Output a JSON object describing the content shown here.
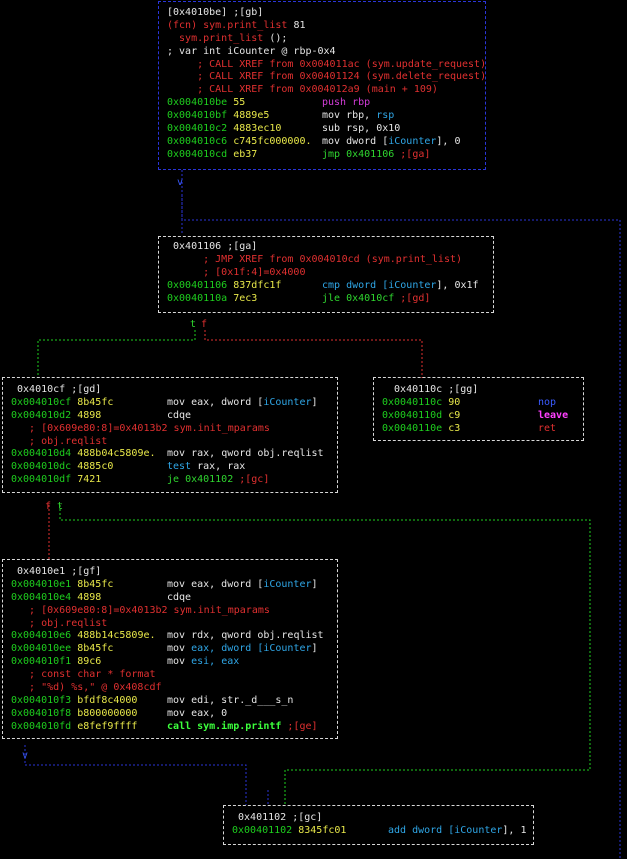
{
  "nodes": {
    "gb": {
      "lines": [
        {
          "t": "[0x4010be] ;[gb]",
          "c": "white"
        },
        {
          "t": "(fcn) sym.print_list 81",
          "parts": [
            {
              "t": "(fcn) sym.print_list ",
              "c": "red"
            },
            {
              "t": "81",
              "c": "white"
            }
          ]
        },
        {
          "t": "  sym.print_list ();",
          "parts": [
            {
              "t": "  sym.print_list ",
              "c": "red"
            },
            {
              "t": "();",
              "c": "white"
            }
          ]
        },
        {
          "t": "; var int iCounter @ rbp-0x4",
          "c": "white"
        },
        {
          "t": "     ; CALL XREF from 0x004011ac (sym.update_request)",
          "c": "red"
        },
        {
          "t": "     ; CALL XREF from 0x00401124 (sym.delete_request)",
          "c": "red"
        },
        {
          "t": "     ; CALL XREF from 0x004012a9 (main + 109)",
          "c": "red"
        },
        {
          "addr": "0x004010be",
          "bytes": "55",
          "op": [
            {
              "t": "push ",
              "c": "purple"
            },
            {
              "t": "rbp",
              "c": "purple"
            }
          ]
        },
        {
          "addr": "0x004010bf",
          "bytes": "4889e5",
          "op": [
            {
              "t": "mov ",
              "c": "white"
            },
            {
              "t": "rbp, ",
              "c": "white"
            },
            {
              "t": "rsp",
              "c": "cyan"
            }
          ]
        },
        {
          "addr": "0x004010c2",
          "bytes": "4883ec10",
          "op": [
            {
              "t": "sub ",
              "c": "white"
            },
            {
              "t": "rsp, 0x10",
              "c": "white"
            }
          ]
        },
        {
          "addr": "0x004010c6",
          "bytes": "c745fc000000.",
          "op": [
            {
              "t": "mov dword [",
              "c": "white"
            },
            {
              "t": "iCounter",
              "c": "cyan"
            },
            {
              "t": "], 0",
              "c": "white"
            }
          ]
        },
        {
          "addr": "0x004010cd",
          "bytes": "eb37",
          "op": [
            {
              "t": "jmp ",
              "c": "green"
            },
            {
              "t": "0x401106 ",
              "c": "green"
            },
            {
              "t": ";[ga]",
              "c": "red"
            }
          ]
        }
      ]
    },
    "ga": {
      "lines": [
        {
          "t": " 0x401106 ;[ga]",
          "c": "white"
        },
        {
          "t": "      ; JMP XREF from 0x004010cd (sym.print_list)",
          "c": "red"
        },
        {
          "t": "      ; [0x1f:4]=0x4000",
          "c": "red"
        },
        {
          "addr": "0x00401106",
          "bytes": "837dfc1f",
          "op": [
            {
              "t": "cmp dword [",
              "c": "cyan"
            },
            {
              "t": "iCounter",
              "c": "cyan"
            },
            {
              "t": "], 0x1f",
              "c": "white"
            }
          ]
        },
        {
          "addr": "0x0040110a",
          "bytes": "7ec3",
          "op": [
            {
              "t": "jle ",
              "c": "green"
            },
            {
              "t": "0x4010cf ",
              "c": "green"
            },
            {
              "t": ";[gd]",
              "c": "red"
            }
          ]
        }
      ]
    },
    "gd": {
      "lines": [
        {
          "t": " 0x4010cf ;[gd]",
          "c": "white"
        },
        {
          "addr": "0x004010cf",
          "bytes": "8b45fc",
          "op": [
            {
              "t": "mov eax, dword [",
              "c": "white"
            },
            {
              "t": "iCounter",
              "c": "cyan"
            },
            {
              "t": "]",
              "c": "white"
            }
          ]
        },
        {
          "addr": "0x004010d2",
          "bytes": "4898",
          "op": [
            {
              "t": "cdqe",
              "c": "white"
            }
          ]
        },
        {
          "t": "   ; [0x609e80:8]=0x4013b2 sym.init_mparams",
          "c": "red"
        },
        {
          "t": "   ; obj.reqlist",
          "c": "red"
        },
        {
          "addr": "0x004010d4",
          "bytes": "488b04c5809e.",
          "op": [
            {
              "t": "mov ",
              "c": "white"
            },
            {
              "t": "rax, qword obj.reqlist",
              "c": "white"
            }
          ]
        },
        {
          "addr": "0x004010dc",
          "bytes": "4885c0",
          "op": [
            {
              "t": "test ",
              "c": "cyan"
            },
            {
              "t": "rax, rax",
              "c": "white"
            }
          ]
        },
        {
          "addr": "0x004010df",
          "bytes": "7421",
          "op": [
            {
              "t": "je ",
              "c": "green"
            },
            {
              "t": "0x401102 ",
              "c": "green"
            },
            {
              "t": ";[gc]",
              "c": "red"
            }
          ]
        }
      ]
    },
    "gg": {
      "lines": [
        {
          "t": "  0x40110c ;[gg]",
          "c": "white"
        },
        {
          "addr": "0x0040110c",
          "bytes": "90",
          "op": [
            {
              "t": "nop",
              "c": "blue"
            }
          ]
        },
        {
          "addr": "0x0040110d",
          "bytes": "c9",
          "op": [
            {
              "t": "leave",
              "c": "mag"
            }
          ]
        },
        {
          "addr": "0x0040110e",
          "bytes": "c3",
          "op": [
            {
              "t": "ret",
              "c": "red"
            }
          ]
        }
      ]
    },
    "gf": {
      "lines": [
        {
          "t": " 0x4010e1 ;[gf]",
          "c": "white"
        },
        {
          "addr": "0x004010e1",
          "bytes": "8b45fc",
          "op": [
            {
              "t": "mov eax, dword [",
              "c": "white"
            },
            {
              "t": "iCounter",
              "c": "cyan"
            },
            {
              "t": "]",
              "c": "white"
            }
          ]
        },
        {
          "addr": "0x004010e4",
          "bytes": "4898",
          "op": [
            {
              "t": "cdqe",
              "c": "white"
            }
          ]
        },
        {
          "t": "   ; [0x609e80:8]=0x4013b2 sym.init_mparams",
          "c": "red"
        },
        {
          "t": "   ; obj.reqlist",
          "c": "red"
        },
        {
          "addr": "0x004010e6",
          "bytes": "488b14c5809e.",
          "op": [
            {
              "t": "mov ",
              "c": "white"
            },
            {
              "t": "rdx, qword obj.reqlist",
              "c": "white"
            }
          ]
        },
        {
          "addr": "0x004010ee",
          "bytes": "8b45fc",
          "op": [
            {
              "t": "mov ",
              "c": "white"
            },
            {
              "t": "eax, dword [",
              "c": "cyan"
            },
            {
              "t": "iCounter",
              "c": "cyan"
            },
            {
              "t": "]",
              "c": "white"
            }
          ]
        },
        {
          "addr": "0x004010f1",
          "bytes": "89c6",
          "op": [
            {
              "t": "mov ",
              "c": "white"
            },
            {
              "t": "esi, eax",
              "c": "cyan"
            }
          ]
        },
        {
          "t": "   ; const char * format",
          "c": "red"
        },
        {
          "t": "   ; \"%d) %s,\" @ 0x408cdf",
          "c": "red"
        },
        {
          "addr": "0x004010f3",
          "bytes": "bfdf8c4000",
          "op": [
            {
              "t": "mov edi, str._d___s_n",
              "c": "white"
            }
          ]
        },
        {
          "addr": "0x004010f8",
          "bytes": "b800000000",
          "op": [
            {
              "t": "mov eax, 0",
              "c": "white"
            }
          ]
        },
        {
          "addr": "0x004010fd",
          "bytes": "e8fef9ffff",
          "op": [
            {
              "t": "call sym.imp.printf ",
              "c": "callg"
            },
            {
              "t": ";[ge]",
              "c": "red"
            }
          ]
        }
      ]
    },
    "gc": {
      "lines": [
        {
          "t": " 0x401102 ;[gc]",
          "c": "white"
        },
        {
          "addr": "0x00401102",
          "bytes": "8345fc01",
          "op": [
            {
              "t": "add dword [",
              "c": "cyan"
            },
            {
              "t": "iCounter",
              "c": "cyan"
            },
            {
              "t": "], 1",
              "c": "white"
            }
          ]
        }
      ]
    }
  },
  "edge_labels": {
    "ga_true": "t",
    "ga_false": "f",
    "gd_false": "f",
    "gd_true": "t",
    "gb_down": "v",
    "gf_down": "v"
  },
  "colors": {
    "background": "#000000",
    "edge_blue": "#2a35d8",
    "edge_green": "#1ecf1e",
    "edge_red": "#e03030",
    "border_white": "#d8d8d8"
  }
}
